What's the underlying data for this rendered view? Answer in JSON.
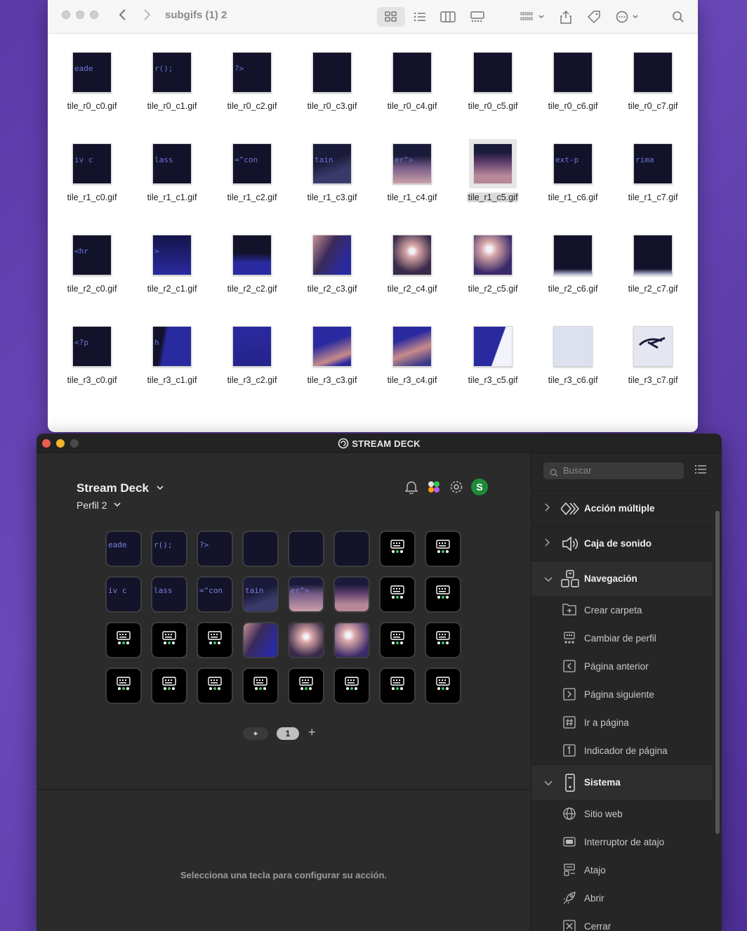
{
  "finder": {
    "title": "subgifs (1) 2",
    "files": [
      [
        "tile_r0_c0.gif",
        "tile_r0_c1.gif",
        "tile_r0_c2.gif",
        "tile_r0_c3.gif",
        "tile_r0_c4.gif",
        "tile_r0_c5.gif",
        "tile_r0_c6.gif",
        "tile_r0_c7.gif"
      ],
      [
        "tile_r1_c0.gif",
        "tile_r1_c1.gif",
        "tile_r1_c2.gif",
        "tile_r1_c3.gif",
        "tile_r1_c4.gif",
        "tile_r1_c5.gif",
        "tile_r1_c6.gif",
        "tile_r1_c7.gif"
      ],
      [
        "tile_r2_c0.gif",
        "tile_r2_c1.gif",
        "tile_r2_c2.gif",
        "tile_r2_c3.gif",
        "tile_r2_c4.gif",
        "tile_r2_c5.gif",
        "tile_r2_c6.gif",
        "tile_r2_c7.gif"
      ],
      [
        "tile_r3_c0.gif",
        "tile_r3_c1.gif",
        "tile_r3_c2.gif",
        "tile_r3_c3.gif",
        "tile_r3_c4.gif",
        "tile_r3_c5.gif",
        "tile_r3_c6.gif",
        "tile_r3_c7.gif"
      ]
    ],
    "thumb_text": {
      "r0c0": "eade",
      "r0c1": "r();",
      "r0c2": "?>",
      "r1c0": "iv c",
      "r1c1": "lass",
      "r1c2": "=\"con",
      "r1c3": "tain",
      "r1c4": "er\">",
      "r1c6": "ext-p",
      "r1c7": "rima",
      "r2c0": "<hr",
      "r2c1": ">",
      "r3c0": "<?p",
      "r3c1": "h"
    },
    "selected_file": "tile_r1_c5.gif"
  },
  "streamdeck": {
    "app_title": "STREAM DECK",
    "device_name": "Stream Deck",
    "profile_name": "Perfil 2",
    "avatar_letter": "S",
    "key_text": {
      "k00": "eade",
      "k01": "r();",
      "k02": "?>",
      "k10": "iv c",
      "k11": "lass",
      "k12": "=\"con",
      "k13": "tain",
      "k14": "er\">"
    },
    "pager": {
      "pin_glyph": "✦",
      "current_page": "1",
      "add_glyph": "+"
    },
    "hint": "Selecciona una tecla para configurar su acción.",
    "search_placeholder": "Buscar",
    "categories": {
      "multi_action": "Acción múltiple",
      "soundboard": "Caja de sonido",
      "navigation": "Navegación",
      "system": "Sistema"
    },
    "navigation_actions": [
      "Crear carpeta",
      "Cambiar de perfil",
      "Página anterior",
      "Página siguiente",
      "Ir a página",
      "Indicador de página"
    ],
    "system_actions": [
      "Sitio web",
      "Interruptor de atajo",
      "Atajo",
      "Abrir",
      "Cerrar"
    ]
  },
  "colors": {
    "desktop": "#5b3aa8",
    "sd_close": "#ed5c52",
    "sd_minimize": "#f3b42b",
    "sd_zoom": "#4a4a4a",
    "avatar": "#1f8a3a",
    "tile_dark": "#12122a",
    "tile_blue": "#2a2aa0"
  }
}
